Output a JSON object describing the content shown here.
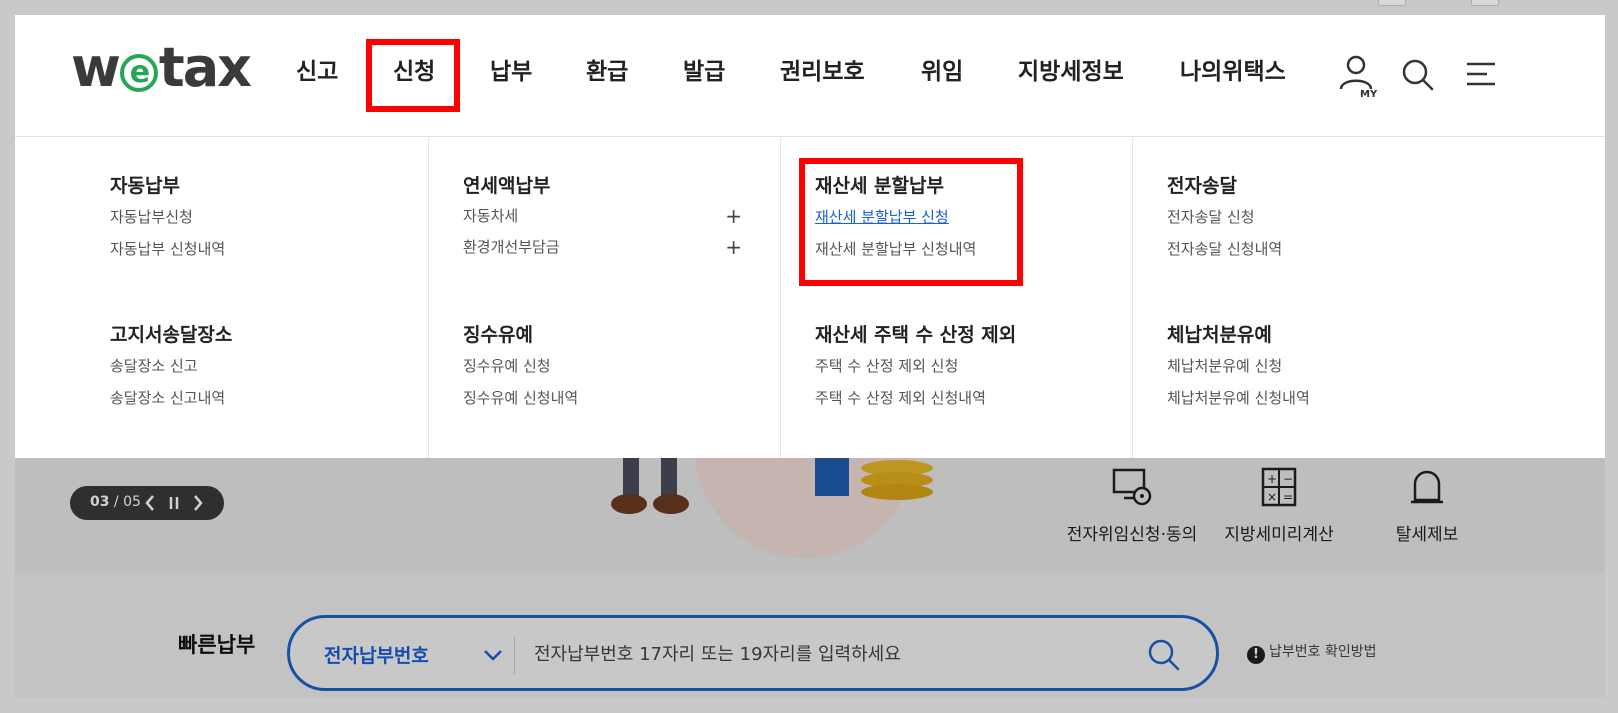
{
  "header": {
    "logo_text": "wetax",
    "nav": [
      {
        "label": "신고"
      },
      {
        "label": "신청"
      },
      {
        "label": "납부"
      },
      {
        "label": "환급"
      },
      {
        "label": "발급"
      },
      {
        "label": "권리보호"
      },
      {
        "label": "위임"
      },
      {
        "label": "지방세정보"
      },
      {
        "label": "나의위택스"
      }
    ],
    "my_icon_label": "MY"
  },
  "mega_menu": {
    "columns": [
      {
        "groups": [
          {
            "title": "자동납부",
            "links": [
              "자동납부신청",
              "자동납부 신청내역"
            ]
          },
          {
            "title": "고지서송달장소",
            "links": [
              "송달장소 신고",
              "송달장소 신고내역"
            ]
          }
        ]
      },
      {
        "groups": [
          {
            "title": "연세액납부",
            "links": [
              "자동차세",
              "환경개선부담금"
            ]
          },
          {
            "title": "징수유예",
            "links": [
              "징수유예 신청",
              "징수유예 신청내역"
            ]
          }
        ]
      },
      {
        "groups": [
          {
            "title": "재산세 분할납부",
            "links": [
              "재산세 분할납부 신청",
              "재산세 분할납부 신청내역"
            ]
          },
          {
            "title": "재산세 주택 수 산정 제외",
            "links": [
              "주택 수 산정 제외 신청",
              "주택 수 산정 제외 신청내역"
            ]
          }
        ]
      },
      {
        "groups": [
          {
            "title": "전자송달",
            "links": [
              "전자송달 신청",
              "전자송달 신청내역"
            ]
          },
          {
            "title": "체납처분유예",
            "links": [
              "체납처분유예 신청",
              "체납처분유예 신청내역"
            ]
          }
        ]
      }
    ]
  },
  "slider": {
    "current": "03",
    "separator": " / ",
    "total": "05"
  },
  "quick_icons": [
    {
      "label": "전자위임신청·동의",
      "icon": "monitor-lock-icon"
    },
    {
      "label": "지방세미리계산",
      "icon": "calculator-icon"
    },
    {
      "label": "탈세제보",
      "icon": "siren-icon"
    }
  ],
  "quick_pay": {
    "label": "빠른납부",
    "select_value": "전자납부번호",
    "input_placeholder": "전자납부번호 17자리 또는 19자리를 입력하세요",
    "input_value": "",
    "help_icon": "!",
    "help_text": "납부번호 확인방법"
  },
  "colors": {
    "highlight_box": "#ff0000",
    "accent_blue": "#1a64c8",
    "logo_green": "#25a855"
  }
}
